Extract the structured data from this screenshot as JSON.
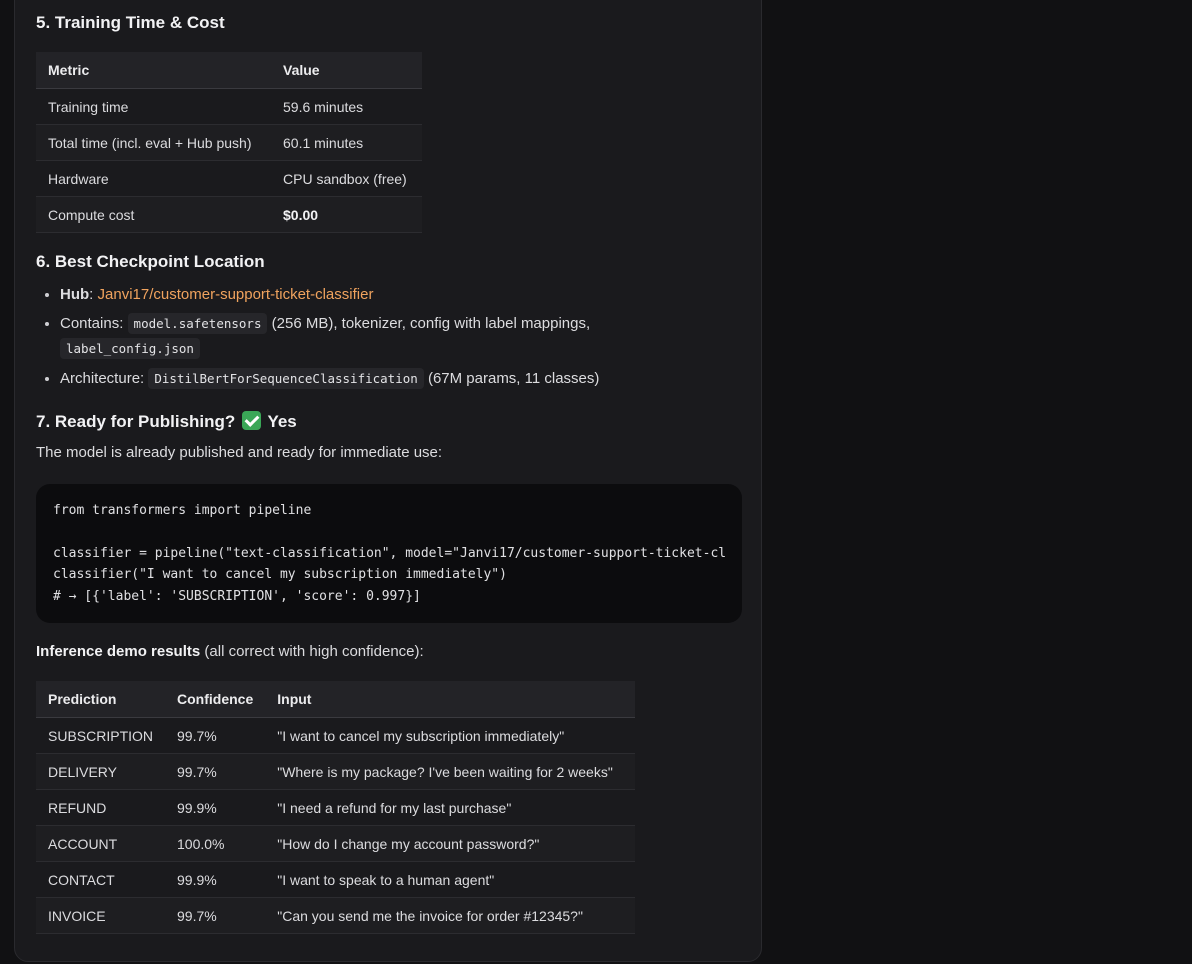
{
  "section5": {
    "heading": "5. Training Time & Cost",
    "columns": [
      "Metric",
      "Value"
    ],
    "rows": [
      [
        "Training time",
        "59.6 minutes"
      ],
      [
        "Total time (incl. eval + Hub push)",
        "60.1 minutes"
      ],
      [
        "Hardware",
        "CPU sandbox (free)"
      ],
      [
        "Compute cost",
        "$0.00"
      ]
    ]
  },
  "section6": {
    "heading": "6. Best Checkpoint Location",
    "hub_label": "Hub",
    "hub_sep": ": ",
    "hub_link": "Janvi17/customer-support-ticket-classifier",
    "contains_prefix": "Contains: ",
    "contains_code1": "model.safetensors",
    "contains_mid": " (256 MB), tokenizer, config with label mappings,",
    "contains_code2": "label_config.json",
    "arch_prefix": "Architecture: ",
    "arch_code": "DistilBertForSequenceClassification",
    "arch_suffix": " (67M params, 11 classes)"
  },
  "section7": {
    "heading_prefix": "7. Ready for Publishing? ",
    "heading_suffix": " Yes",
    "icon": "check-mark-button-icon",
    "intro": "The model is already published and ready for immediate use:",
    "code_lines": [
      "from transformers import pipeline",
      "",
      "classifier = pipeline(\"text-classification\", model=\"Janvi17/customer-support-ticket-cl",
      "classifier(\"I want to cancel my subscription immediately\")",
      "# → [{'label': 'SUBSCRIPTION', 'score': 0.997}]"
    ],
    "demo_bold": "Inference demo results",
    "demo_rest": " (all correct with high confidence):",
    "demo_columns": [
      "Prediction",
      "Confidence",
      "Input"
    ],
    "demo_rows": [
      [
        "SUBSCRIPTION",
        "99.7%",
        "\"I want to cancel my subscription immediately\""
      ],
      [
        "DELIVERY",
        "99.7%",
        "\"Where is my package? I've been waiting for 2 weeks\""
      ],
      [
        "REFUND",
        "99.9%",
        "\"I need a refund for my last purchase\""
      ],
      [
        "ACCOUNT",
        "100.0%",
        "\"How do I change my account password?\""
      ],
      [
        "CONTACT",
        "99.9%",
        "\"I want to speak to a human agent\""
      ],
      [
        "INVOICE",
        "99.7%",
        "\"Can you send me the invoice for order #12345?\""
      ]
    ]
  }
}
